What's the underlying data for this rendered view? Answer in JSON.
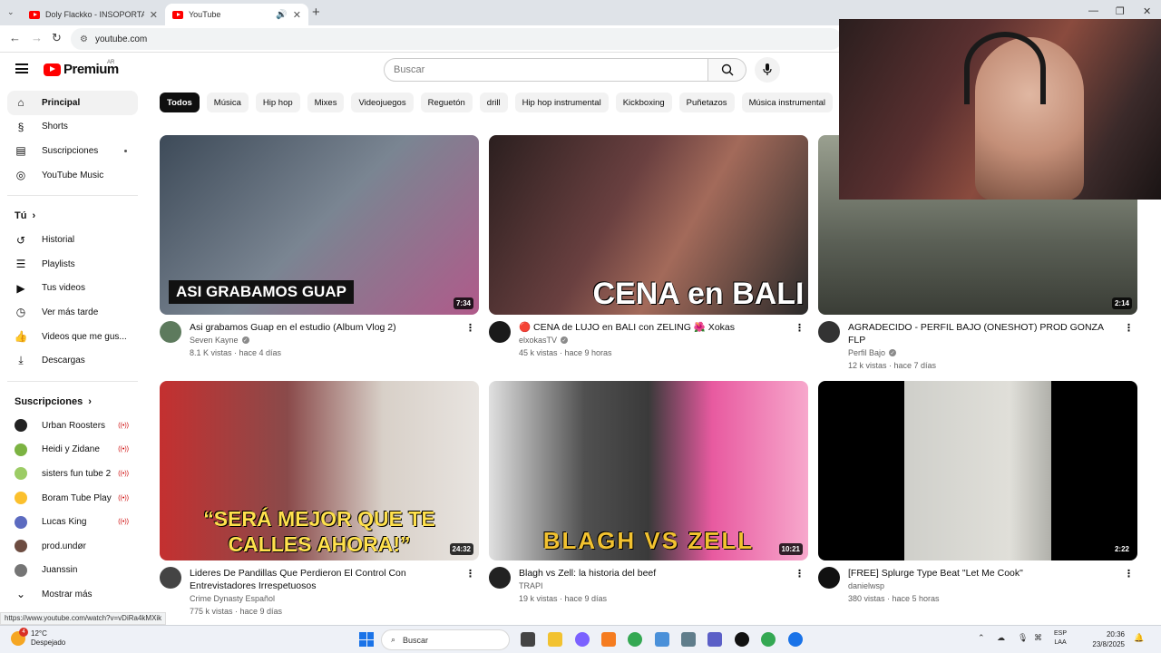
{
  "browser": {
    "tabs": [
      {
        "title": "Doly Flackko - INSOPORTABLE",
        "active": false
      },
      {
        "title": "YouTube",
        "active": true
      }
    ],
    "address": "youtube.com",
    "status_link": "https://www.youtube.com/watch?v=vDiRa4kMXik"
  },
  "header": {
    "logo": "Premium",
    "country": "AR",
    "search_placeholder": "Buscar"
  },
  "sidebar": {
    "main": [
      {
        "label": "Principal",
        "icon": "home-icon",
        "active": true
      },
      {
        "label": "Shorts",
        "icon": "shorts-icon"
      },
      {
        "label": "Suscripciones",
        "icon": "subscriptions-icon",
        "dot": true
      },
      {
        "label": "YouTube Music",
        "icon": "music-icon"
      }
    ],
    "you_heading": "Tú",
    "you": [
      {
        "label": "Historial",
        "icon": "history-icon"
      },
      {
        "label": "Playlists",
        "icon": "playlists-icon"
      },
      {
        "label": "Tus videos",
        "icon": "your-videos-icon"
      },
      {
        "label": "Ver más tarde",
        "icon": "watch-later-icon"
      },
      {
        "label": "Videos que me gus...",
        "icon": "like-icon"
      },
      {
        "label": "Descargas",
        "icon": "download-icon"
      }
    ],
    "subs_heading": "Suscripciones",
    "subs": [
      {
        "label": "Urban Roosters",
        "color": "#222222",
        "live": true
      },
      {
        "label": "Heidi y Zidane",
        "color": "#7cb342",
        "live": true
      },
      {
        "label": "sisters fun tube 2",
        "color": "#9ccc65",
        "live": true
      },
      {
        "label": "Boram Tube Play",
        "color": "#fbc02d",
        "live": true
      },
      {
        "label": "Lucas King",
        "color": "#5c6bc0",
        "live": true
      },
      {
        "label": "prod.undør",
        "color": "#6d4c41",
        "live": false
      },
      {
        "label": "Juanssin",
        "color": "#757575",
        "live": false
      }
    ],
    "show_more": "Mostrar más"
  },
  "chips": [
    "Todos",
    "Música",
    "Hip hop",
    "Mixes",
    "Videojuegos",
    "Reguetón",
    "drill",
    "Hip hop instrumental",
    "Kickboxing",
    "Puñetazos",
    "Música instrumental"
  ],
  "videos": [
    {
      "title": "Asi grabamos Guap en el estudio (Album Vlog 2)",
      "channel": "Seven Kayne",
      "verified": true,
      "stats": "8.1 K vistas · hace 4 días",
      "duration": "7:34",
      "overlay": "ASI GRABAMOS GUAP",
      "thumb_color": "#5a6b7a",
      "avatar_color": "#5d7a5d"
    },
    {
      "title": "🔴 CENA de LUJO en BALI con ZELING 🌺 Xokas",
      "channel": "elxokasTV",
      "verified": true,
      "stats": "45 k vistas · hace 9 horas",
      "duration": "",
      "overlay": "CENA en BALI",
      "thumb_color": "#3a2a2a",
      "avatar_color": "#1a1a1a"
    },
    {
      "title": "AGRADECIDO - PERFIL BAJO (ONESHOT) PROD GONZA FLP",
      "channel": "Perfil Bajo",
      "verified": true,
      "stats": "12 k vistas · hace 7 días",
      "duration": "2:14",
      "overlay": "",
      "thumb_color": "#6b7067",
      "avatar_color": "#333333"
    },
    {
      "title": "Lideres De Pandillas Que Perdieron El Control Con Entrevistadores Irrespetuosos",
      "channel": "Crime Dynasty Español",
      "verified": false,
      "stats": "775 k vistas · hace 9 días",
      "duration": "24:32",
      "overlay": "“SERÁ MEJOR QUE TE CALLES AHORA!”",
      "thumb_color": "#7a3a3a",
      "avatar_color": "#444444"
    },
    {
      "title": "Blagh vs Zell: la historia del beef",
      "channel": "TRAPI",
      "verified": false,
      "stats": "19 k vistas · hace 9 días",
      "duration": "10:21",
      "overlay": "BLAGH VS ZELL",
      "thumb_color": "#9a4a7a",
      "avatar_color": "#222222"
    },
    {
      "title": "[FREE] Splurge Type Beat \"Let Me Cook\"",
      "channel": "danielwsp",
      "verified": false,
      "stats": "380 vistas · hace 5 horas",
      "duration": "2:22",
      "overlay": "",
      "thumb_color": "#1a1a1a",
      "avatar_color": "#111111"
    }
  ],
  "taskbar": {
    "weather_temp": "12°C",
    "weather_desc": "Despejado",
    "weather_badge": "4",
    "search_label": "Buscar",
    "lang_1": "ESP",
    "lang_2": "LAA",
    "time": "20:36",
    "date": "23/8/2025"
  }
}
